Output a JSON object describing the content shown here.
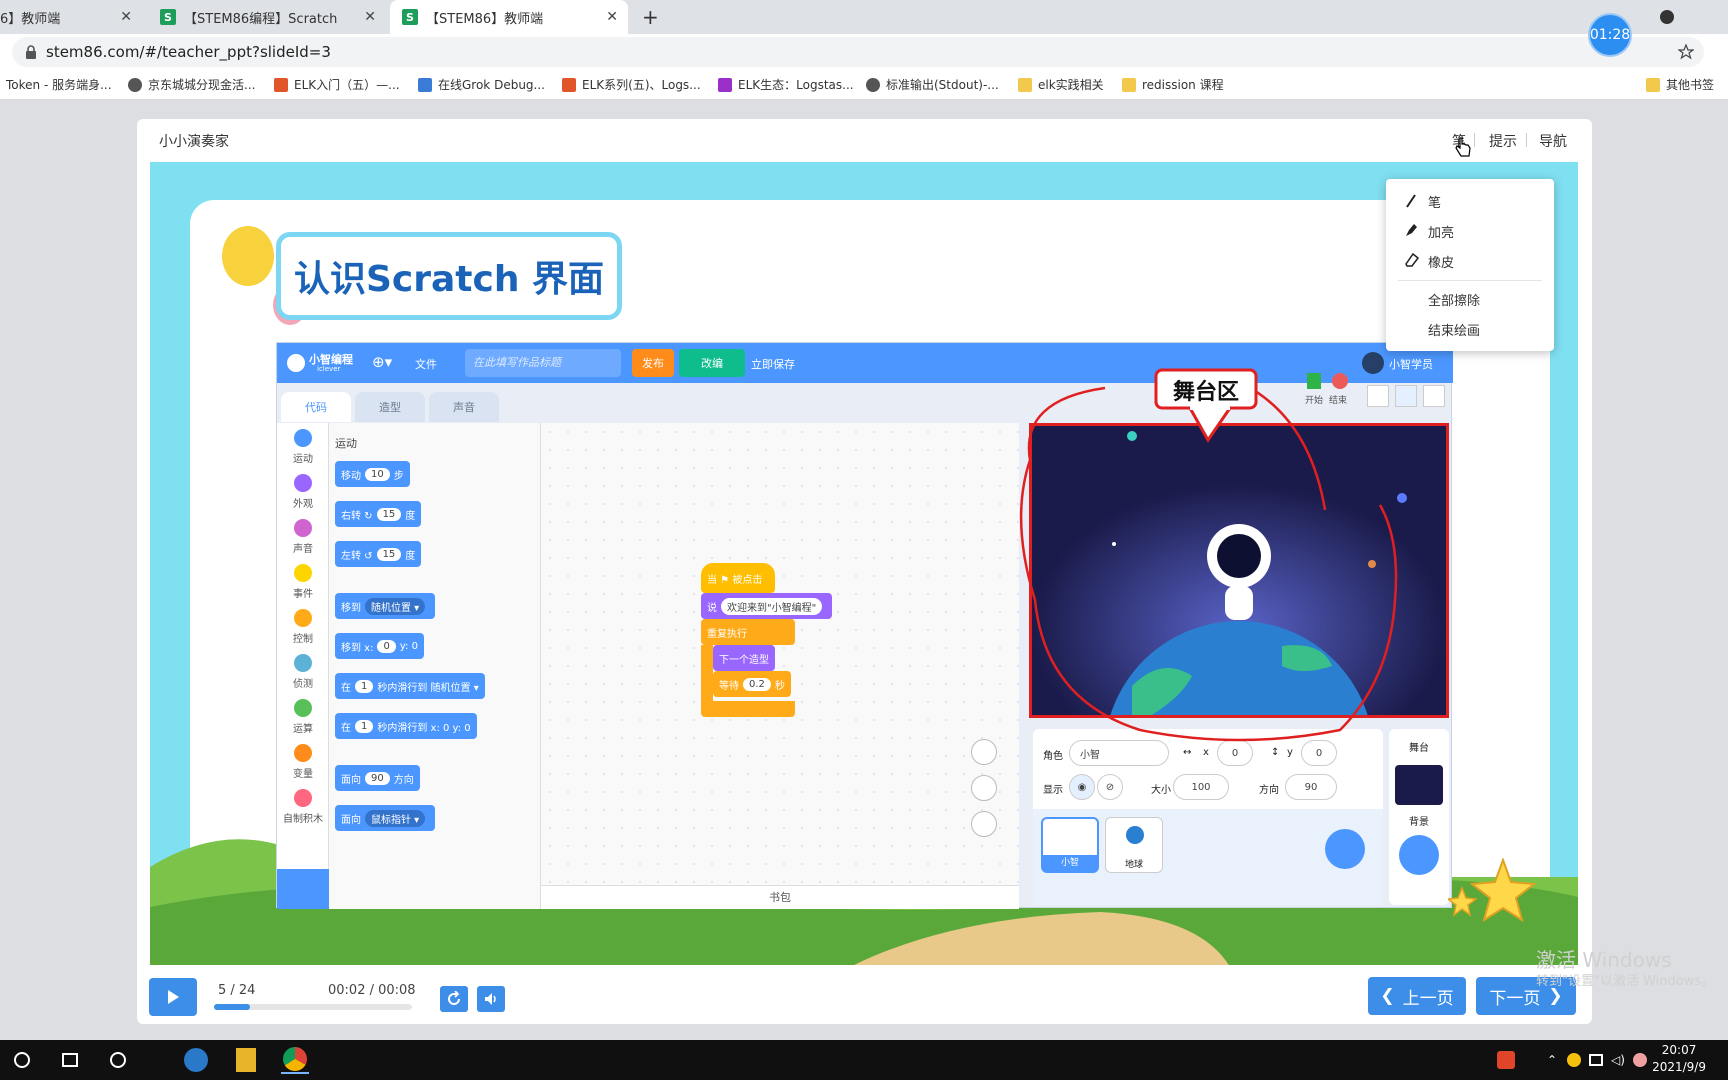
{
  "browser": {
    "tabs": [
      {
        "title": "6】教师端",
        "active": false
      },
      {
        "title": "【STEM86编程】Scratch",
        "active": false
      },
      {
        "title": "【STEM86】教师端",
        "active": true
      }
    ],
    "favicon_letter": "S",
    "close_glyph": "✕",
    "newtab_glyph": "+",
    "url": "stem86.com/#/teacher_ppt?slideId=3",
    "timer": "01:28",
    "bookmarks": [
      "Token - 服务端身...",
      "京东城城分现金活...",
      "ELK入门（五）—...",
      "在线Grok Debug...",
      "ELK系列(五)、Logs...",
      "ELK生态：Logstas...",
      "标准输出(Stdout)-...",
      "elk实践相关",
      "redission 课程"
    ],
    "other_bookmarks": "其他书签"
  },
  "header": {
    "lesson_title": "小小演奏家",
    "nav": [
      "笔",
      "提示",
      "导航"
    ]
  },
  "slide": {
    "title": "认识Scratch 界面",
    "callout": "舞台区",
    "scratch": {
      "brand": "小智编程",
      "brand_sub": "iclever",
      "menu_file": "文件",
      "title_placeholder": "在此填写作品标题",
      "publish": "发布",
      "adapt": "改编",
      "save_now": "立即保存",
      "user": "小智学员",
      "tabs": [
        "代码",
        "造型",
        "声音"
      ],
      "categories": [
        {
          "label": "运动",
          "color": "#4c97ff"
        },
        {
          "label": "外观",
          "color": "#9966ff"
        },
        {
          "label": "声音",
          "color": "#cf63cf"
        },
        {
          "label": "事件",
          "color": "#ffd500"
        },
        {
          "label": "控制",
          "color": "#ffab19"
        },
        {
          "label": "侦测",
          "color": "#5cb1d6"
        },
        {
          "label": "运算",
          "color": "#59c059"
        },
        {
          "label": "变量",
          "color": "#ff8c1a"
        },
        {
          "label": "自制积木",
          "color": "#ff6680"
        }
      ],
      "palette_title": "运动",
      "blocks": [
        {
          "a": "移动",
          "v": "10",
          "b": "步"
        },
        {
          "a": "右转 ↻",
          "v": "15",
          "b": "度"
        },
        {
          "a": "左转 ↺",
          "v": "15",
          "b": "度"
        },
        {
          "a": "移到",
          "v": "随机位置 ▾",
          "b": ""
        },
        {
          "a": "移到 x:",
          "v": "0",
          "b": "y: 0"
        },
        {
          "a": "在",
          "v": "1",
          "b": "秒内滑行到  随机位置 ▾"
        },
        {
          "a": "在",
          "v": "1",
          "b": "秒内滑行到 x: 0  y: 0"
        },
        {
          "a": "面向",
          "v": "90",
          "b": "方向"
        },
        {
          "a": "面向",
          "v": "鼠标指针 ▾",
          "b": ""
        }
      ],
      "script": {
        "hat": "当 ⚑ 被点击",
        "say": "说",
        "say_value": "欢迎来到\"小智编程\"",
        "repeat": "重复执行",
        "next_costume": "下一个造型",
        "wait": "等待",
        "wait_value": "0.2",
        "wait_unit": "秒"
      },
      "backpack": "书包",
      "start": "开始",
      "stop": "结束",
      "sprite": {
        "label_role": "角色",
        "name": "小智",
        "label_x": "x",
        "x": "0",
        "label_y": "y",
        "y": "0",
        "label_show": "显示",
        "label_size": "大小",
        "size": "100",
        "label_dir": "方向",
        "direction": "90",
        "thumbs": [
          "小智",
          "地球"
        ]
      },
      "stage_panel": {
        "title": "舞台",
        "backdrop": "背景"
      }
    }
  },
  "pen_menu": {
    "items": [
      "笔",
      "加亮",
      "橡皮"
    ],
    "actions": [
      "全部擦除",
      "结束绘画"
    ]
  },
  "player": {
    "page": "5 / 24",
    "time": "00:02 / 00:08",
    "progress": 0.18,
    "prev": "上一页",
    "next": "下一页"
  },
  "watermark": {
    "line1": "激活 Windows",
    "line2": "转到\"设置\"以激活 Windows。"
  },
  "taskbar": {
    "time": "20:07",
    "date": "2021/9/9"
  },
  "colors": {
    "accent": "#3d8ee8",
    "scratch_blue": "#4c97ff",
    "annotation_red": "#e02020"
  }
}
